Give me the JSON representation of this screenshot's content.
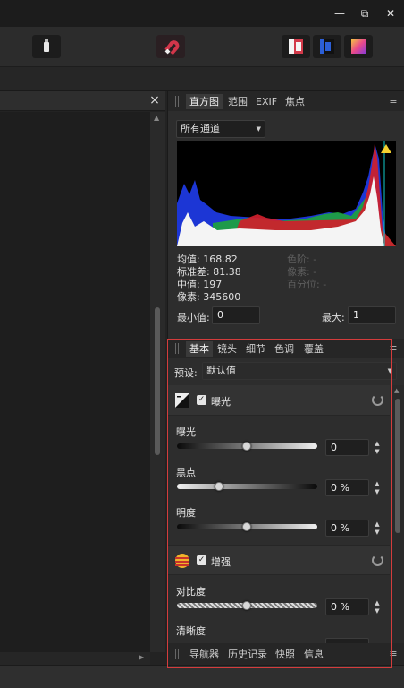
{
  "window": {
    "minimize": "—",
    "restore": "⧉",
    "close": "✕"
  },
  "toolbar": {
    "buttons": [
      {
        "name": "mode-toggle-icon"
      },
      {
        "name": "magnet-snap-icon"
      },
      {
        "name": "persona-photo-icon"
      },
      {
        "name": "persona-tone-icon"
      },
      {
        "name": "persona-export-icon"
      }
    ]
  },
  "document": {
    "close": "×"
  },
  "histogram_panel": {
    "tabs": [
      "直方图",
      "范围",
      "EXIF",
      "焦点"
    ],
    "channel": "所有通道",
    "stats": {
      "mean": "均值: 168.82",
      "stddev": "标准差: 81.38",
      "median": "中值: 197",
      "pixels": "像素: 345600",
      "level": "色阶: -",
      "count": "像素: -",
      "percentile": "百分位: -"
    },
    "min_label": "最小值:",
    "min_value": "0",
    "max_label": "最大:",
    "max_value": "1"
  },
  "develop_panel": {
    "tabs": [
      "基本",
      "镜头",
      "细节",
      "色调",
      "覆盖"
    ],
    "preset_label": "预设:",
    "preset_value": "默认值",
    "exposure_section": {
      "title": "曝光",
      "sliders": [
        {
          "label": "曝光",
          "value": "0",
          "level": 0.5
        },
        {
          "label": "黑点",
          "value": "0 %",
          "level": 0.3
        },
        {
          "label": "明度",
          "value": "0 %",
          "level": 0.5
        }
      ]
    },
    "enhance_section": {
      "title": "增强",
      "sliders": [
        {
          "label": "对比度",
          "value": "0 %",
          "level": 0.5
        },
        {
          "label": "清晰度",
          "value": "",
          "level": 0.5
        }
      ]
    }
  },
  "bottom_panel": {
    "tabs": [
      "导航器",
      "历史记录",
      "快照",
      "信息"
    ]
  },
  "colors": {
    "highlight_box": "#d43c3c",
    "accent_tab": "#3a3a3a"
  }
}
